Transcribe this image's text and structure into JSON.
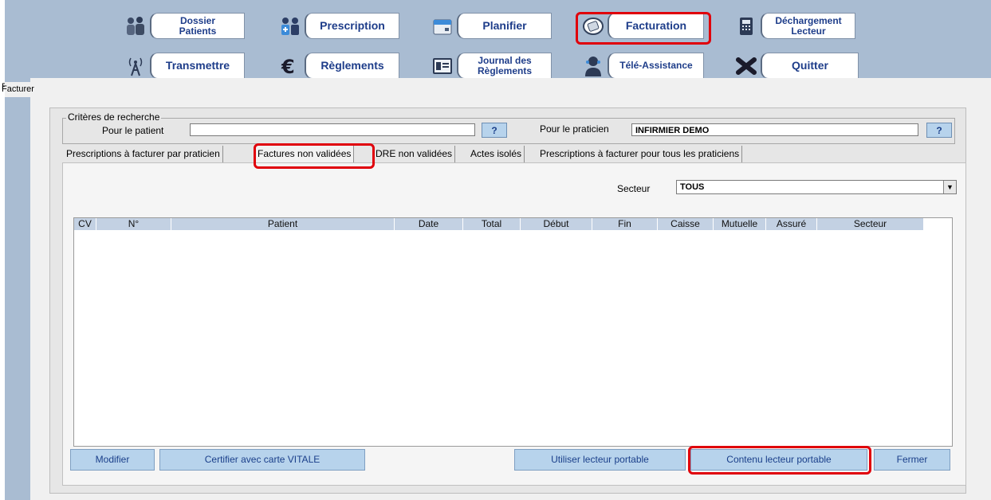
{
  "toolbar": {
    "row1": [
      {
        "label": "Dossier\nPatients",
        "icon": "patients-icon"
      },
      {
        "label": "Prescription",
        "icon": "prescription-icon"
      },
      {
        "label": "Planifier",
        "icon": "calendar-icon"
      },
      {
        "label": "Facturation",
        "icon": "invoice-icon"
      },
      {
        "label": "Déchargement\nLecteur",
        "icon": "reader-icon"
      }
    ],
    "row2": [
      {
        "label": "Transmettre",
        "icon": "antenna-icon"
      },
      {
        "label": "Règlements",
        "icon": "euro-icon"
      },
      {
        "label": "Journal des\nRèglements",
        "icon": "journal-icon"
      },
      {
        "label": "Télé-Assistance",
        "icon": "support-icon"
      },
      {
        "label": "Quitter",
        "icon": "close-icon"
      }
    ]
  },
  "window": {
    "title": "Facturer"
  },
  "search": {
    "legend": "Critères de recherche",
    "patient_label": "Pour le patient",
    "patient_value": "",
    "help": "?",
    "praticien_label": "Pour le praticien",
    "praticien_value": "INFIRMIER DEMO"
  },
  "tabs": [
    "Prescriptions à facturer par praticien",
    "Factures non validées",
    "DRE non validées",
    "Actes isolés",
    "Prescriptions à facturer pour tous les praticiens"
  ],
  "secteur": {
    "label": "Secteur",
    "value": "TOUS"
  },
  "table": {
    "columns": [
      "CV",
      "N°",
      "Patient",
      "Date",
      "Total",
      "Début",
      "Fin",
      "Caisse",
      "Mutuelle",
      "Assuré",
      "Secteur"
    ]
  },
  "buttons": {
    "modifier": "Modifier",
    "certifier": "Certifier avec carte VITALE",
    "utiliser": "Utiliser lecteur portable",
    "contenu": "Contenu lecteur portable",
    "fermer": "Fermer"
  },
  "colors": {
    "toolbar_bg": "#a9bcd2",
    "highlight": "#e0000b",
    "label_text": "#1e3d8a"
  }
}
